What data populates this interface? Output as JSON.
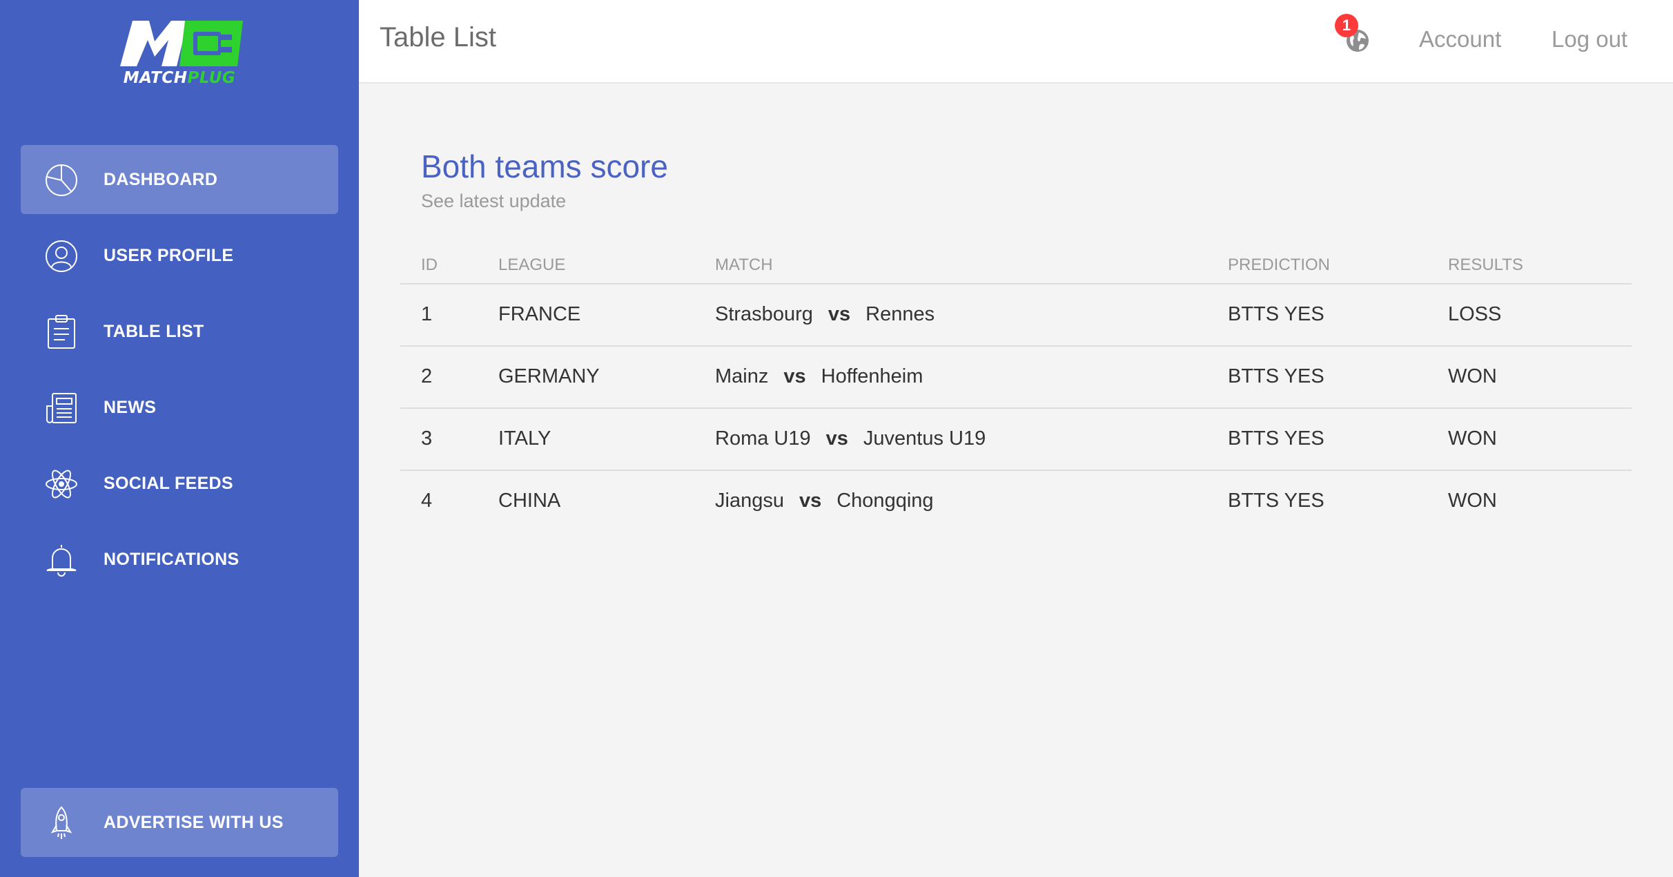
{
  "brand": {
    "logo_text_match": "MATCH",
    "logo_text_plug": "PLUG",
    "primary_color": "#4460c0",
    "accent_color": "#2ed12e"
  },
  "sidebar": {
    "items": [
      {
        "label": "DASHBOARD",
        "icon": "pie-chart-icon",
        "active": true
      },
      {
        "label": "USER PROFILE",
        "icon": "user-icon",
        "active": false
      },
      {
        "label": "TABLE LIST",
        "icon": "clipboard-icon",
        "active": false
      },
      {
        "label": "NEWS",
        "icon": "newspaper-icon",
        "active": false
      },
      {
        "label": "SOCIAL FEEDS",
        "icon": "atom-icon",
        "active": false
      },
      {
        "label": "NOTIFICATIONS",
        "icon": "bell-icon",
        "active": false
      }
    ],
    "advertise": {
      "label": "ADVERTISE WITH US",
      "icon": "rocket-icon"
    }
  },
  "header": {
    "title": "Table List",
    "notification_count": "1",
    "account_label": "Account",
    "logout_label": "Log out"
  },
  "card": {
    "title": "Both teams score",
    "subtitle": "See latest update"
  },
  "table": {
    "columns": [
      "ID",
      "LEAGUE",
      "MATCH",
      "PREDICTION",
      "RESULTS"
    ],
    "rows": [
      {
        "id": "1",
        "league": "FRANCE",
        "home": "Strasbourg",
        "vs": "vs",
        "away": "Rennes",
        "prediction": "BTTS YES",
        "result": "LOSS"
      },
      {
        "id": "2",
        "league": "GERMANY",
        "home": "Mainz",
        "vs": "vs",
        "away": "Hoffenheim",
        "prediction": "BTTS YES",
        "result": "WON"
      },
      {
        "id": "3",
        "league": "ITALY",
        "home": "Roma U19",
        "vs": "vs",
        "away": "Juventus U19",
        "prediction": "BTTS YES",
        "result": "WON"
      },
      {
        "id": "4",
        "league": "CHINA",
        "home": "Jiangsu",
        "vs": "vs",
        "away": "Chongqing",
        "prediction": "BTTS YES",
        "result": "WON"
      }
    ]
  }
}
